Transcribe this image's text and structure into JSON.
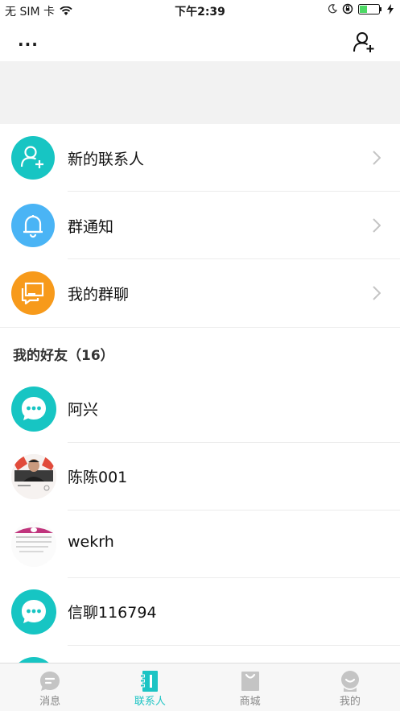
{
  "status_bar": {
    "carrier": "无 SIM 卡",
    "time": "下午2:39"
  },
  "nav": {
    "more_label": "..."
  },
  "functions": [
    {
      "label": "新的联系人",
      "icon": "add-contact-icon",
      "color": "#17c5c3"
    },
    {
      "label": "群通知",
      "icon": "bell-icon",
      "color": "#4ab4f5"
    },
    {
      "label": "我的群聊",
      "icon": "group-chat-icon",
      "color": "#f79a1b"
    }
  ],
  "friends_section": {
    "title": "我的好友（16）"
  },
  "friends": [
    {
      "name": "阿兴",
      "avatar": "default-chat-avatar"
    },
    {
      "name": "陈陈001",
      "avatar": "photo-avatar"
    },
    {
      "name": "wekrh",
      "avatar": "document-avatar"
    },
    {
      "name": "信聊116794",
      "avatar": "default-chat-avatar"
    }
  ],
  "tabs": [
    {
      "label": "消息",
      "icon": "message-icon",
      "active": false
    },
    {
      "label": "联系人",
      "icon": "contacts-icon",
      "active": true
    },
    {
      "label": "商城",
      "icon": "shop-bag-icon",
      "active": false
    },
    {
      "label": "我的",
      "icon": "profile-icon",
      "active": false
    }
  ],
  "colors": {
    "accent": "#1cc4c4",
    "inactive_tab": "#888888"
  }
}
